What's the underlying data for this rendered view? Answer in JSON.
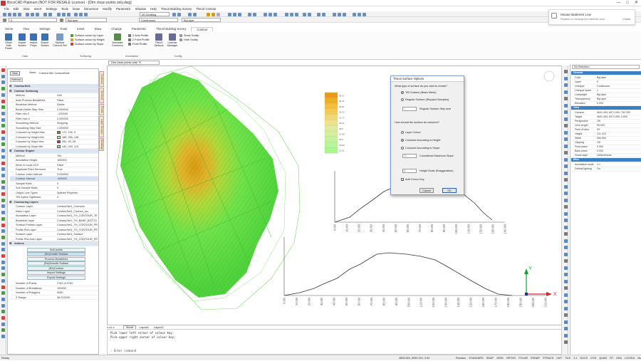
{
  "window": {
    "title": "BricsCAD Platinum (NOT FOR RESALE License) - [Dtm clean points only.dwg]",
    "controls": [
      "—",
      "□",
      "✕"
    ]
  },
  "menu": [
    "File",
    "Edit",
    "View",
    "Insert",
    "Settings",
    "Tools",
    "Draw",
    "Dimension",
    "Modify",
    "Parametric",
    "Window",
    "Help",
    "Theo3 Building Survey",
    "Theo3 Contour"
  ],
  "toolbar": {
    "workspace": "2D Drafting",
    "layer": "0",
    "linetype": "Continuous",
    "color": "ByLayer",
    "lineweight": "ByLayer"
  },
  "ribbon": {
    "tabs": [
      "Home",
      "View",
      "Settings",
      "Tools",
      "Insert",
      "Draw",
      "Change",
      "Parametric",
      "Theo3 Building Survey",
      "Contour"
    ],
    "active_tab": "Contour",
    "buttons": [
      "Show Side Panel",
      "Import Nodes",
      "Import Polys",
      "Export Nodes",
      "Surface Current Set",
      "Annotate Contours",
      "Theo3 Options",
      "License Manager"
    ],
    "small_buttons": [
      "Surface colour by Layer",
      "Surface colour by Height",
      "Surface colour by Slope",
      "X Axis Profile",
      "2 Point Profile",
      "Profil Profile",
      "Show Tooltip",
      "Hide Tooltip"
    ],
    "groups": [
      "Data",
      "Surfacing",
      "Annotation",
      "Config"
    ]
  },
  "notification": {
    "title": "Mouse Batteries Low",
    "body": "Replace or recharge the batteries soon",
    "close": "Close"
  },
  "panel": {
    "new_button": "New",
    "none_button": "None",
    "current_set_label": "Current Set: ContourSet1",
    "refresh_button": "Refresh",
    "rows": [
      {
        "type": "sec",
        "k": "ContourSet1",
        "v": ""
      },
      {
        "type": "sec",
        "k": "Contour Surfacing",
        "v": ""
      },
      {
        "k": "Method",
        "v": "Hull"
      },
      {
        "k": "Auto Process Breaklines",
        "v": "False"
      },
      {
        "k": "Breakline Method",
        "v": "Divide"
      },
      {
        "k": "Break Divide Step Size",
        "v": "2.000000"
      },
      {
        "k": "Filter min Z",
        "v": "-.200000"
      },
      {
        "k": "Filter max Z",
        "v": "2.000000"
      },
      {
        "k": "Smoothing Method",
        "v": "Stepping"
      },
      {
        "k": "Smoothing Step Size",
        "v": "1.000000"
      },
      {
        "k": "Coloured by Height Max",
        "v": "170, 135, 9",
        "sw": "#aa8709"
      },
      {
        "k": "Coloured by Height Min",
        "v": "188, 255, 148",
        "sw": "#bcff94"
      },
      {
        "k": "Coloured by Slope Max",
        "v": "250, 45, 28",
        "sw": "#fa2d1c"
      },
      {
        "k": "Coloured by Slope Min",
        "v": "140, 249, 115",
        "sw": "#8cf973"
      },
      {
        "type": "sec",
        "k": "Contour Engine",
        "v": ""
      },
      {
        "k": "Method",
        "v": "TIN"
      },
      {
        "k": "Annotation Height",
        "v": ".500000"
      },
      {
        "k": "Work in Local UCS",
        "v": "False"
      },
      {
        "k": "Duplicate Point Removal",
        "v": "True"
      },
      {
        "k": "Contour Index Interval",
        "v": "5.000000"
      },
      {
        "type": "sel",
        "k": "Contour Interval",
        "v": ".200000"
      },
      {
        "k": "Sample Ratio",
        "v": "0"
      },
      {
        "k": "Sub Sample Ratio",
        "v": "0"
      },
      {
        "k": "Output Line Types",
        "v": "Splined Polylines"
      },
      {
        "k": "TIN Spline Tightness",
        "v": "0"
      },
      {
        "type": "sec",
        "k": "Contouring Layers",
        "v": ""
      },
      {
        "k": "Contour Layer",
        "v": "ContourSet1_Contours"
      },
      {
        "k": "Index Layer",
        "v": "ContourSet1_Contour_Inc"
      },
      {
        "k": "Annotation Layer",
        "v": "ContourSet1_TH_CONTOUR_TE"
      },
      {
        "k": "Breakline Layer",
        "v": "ContourSet1_TH_BANK_BOTTO"
      },
      {
        "k": "Surface Profiles Layer",
        "v": "ContourSet1_TH_CONTOUR_PR"
      },
      {
        "k": "Profile Plot Layer",
        "v": "ContourSet1_TH_CONTOUR_PR"
      },
      {
        "k": "Surface Layer",
        "v": "ContourSet1_Surface"
      },
      {
        "k": "Profile Plot Axis Layer",
        "v": "ContourSet1_TH_CONTOUR_PR"
      },
      {
        "type": "sec",
        "k": "Actions",
        "v": ""
      }
    ],
    "actions": [
      "Add points",
      "(Re)Create Surface",
      "Process Breaklines",
      "(Re)Smooth Surface",
      "(Re)Contour",
      "Import Settings",
      "Export Settings"
    ],
    "stats": [
      {
        "k": "Number of Points",
        "v": "2781 of 2781"
      },
      {
        "k": "Number of Breaklines",
        "v": "100000"
      },
      {
        "k": "Number of Polygons",
        "v": "5280"
      },
      {
        "k": "Z Range",
        "v": "36.213000"
      }
    ],
    "side_tabs": [
      "Contours",
      "Sections",
      "Points",
      "Layer Groups",
      "Buildings"
    ]
  },
  "document_tab": "Dtm clean points only*",
  "layout_tabs": [
    "Model",
    "Layout1",
    "Layout2"
  ],
  "legend": {
    "values": [
      "38.17",
      "36.31",
      "34.87",
      "33.22",
      "31.72",
      "30.11",
      "28.6",
      "27.08",
      "25.5",
      "23.89",
      "22.31"
    ],
    "colors": [
      "#e79a1a",
      "#edae27",
      "#f1bf3d",
      "#f3cc55",
      "#f2d873",
      "#eee38a",
      "#e3ea98",
      "#d6ef9d",
      "#c7f29d",
      "#b8f498",
      "#acf68f"
    ]
  },
  "profile1": {
    "x_ticks": [
      "0.00",
      "10.00",
      "20.00",
      "30.00",
      "40.00",
      "50.00",
      "60.00",
      "70.00",
      "80.00",
      "90.00",
      "100.00",
      "110.00",
      "120.00",
      "130.00",
      "140.00"
    ]
  },
  "profile2": {
    "x_ticks": [
      "0.00",
      "10.00",
      "20.00",
      "30.00",
      "40.00",
      "50.00",
      "60.00",
      "70.00",
      "80.00",
      "90.00",
      "100.00",
      "110.00",
      "120.00",
      "130.00",
      "140.00",
      "150.00",
      "160.00",
      "170.00",
      "180.00",
      "190.00",
      "200.00",
      "210.00"
    ]
  },
  "ucs": {
    "x": "X",
    "y": "Y"
  },
  "dialog": {
    "title": "Theo3 Surface Options",
    "q1": "What type of surface do you wish to create?",
    "opt_tin": "TIN Surface (Basic Mesh)",
    "opt_regular": "Regular Surface (Stepped Samples)",
    "step_value": "1",
    "step_label": "Regular Surface Step size",
    "q2": "How should the surface be coloured?",
    "opt_layer": "Layer Colour",
    "opt_height": "Coloured According to Height",
    "opt_slope": "Coloured According to Slope",
    "slope_value": "90",
    "slope_label": "Considered Maximum Slope",
    "height_value": "1",
    "height_label": "Height Scale (Exaggeration)",
    "add_keys": "Add Colour Key",
    "cancel": "Cancel",
    "ok": "OK"
  },
  "command": {
    "lines": [
      "Pick lower left corner of colour key:",
      "Pick upper right corner of colour key:"
    ],
    "prompt": ": Enter command"
  },
  "properties": {
    "selector": "No Selection",
    "rows": [
      {
        "type": "sec",
        "k": "General"
      },
      {
        "k": "Color",
        "v": "ByLayer"
      },
      {
        "k": "Layer",
        "v": "0"
      },
      {
        "k": "Linetype",
        "v": "Continuous"
      },
      {
        "k": "Linetype scale",
        "v": "1"
      },
      {
        "k": "Lineweight",
        "v": "ByLayer"
      },
      {
        "k": "Transparency",
        "v": "ByLayer"
      },
      {
        "k": "Elevation",
        "v": "0.000"
      },
      {
        "type": "sec",
        "k": "View"
      },
      {
        "k": "Camera",
        "v": "4641.493, 6071.000, 752.333"
      },
      {
        "k": "Target",
        "v": "4641.493, 6071.000, 0.000"
      },
      {
        "k": "Perspective",
        "v": "Off"
      },
      {
        "k": "Lens length",
        "v": "50.000"
      },
      {
        "k": "Field of view",
        "v": "39"
      },
      {
        "k": "Height",
        "v": "211.223"
      },
      {
        "k": "Width",
        "v": "364.554"
      },
      {
        "k": "Clipping",
        "v": "Off"
      },
      {
        "k": "Front plane",
        "v": "0.000"
      },
      {
        "k": "Back plane",
        "v": "0.000"
      },
      {
        "k": "Visual style",
        "v": "2dWireframe"
      },
      {
        "type": "sec",
        "k": "Misc"
      },
      {
        "k": "Annotation scale",
        "v": "1:1"
      },
      {
        "k": "Default lighting",
        "v": "On"
      }
    ]
  },
  "status": {
    "left": "Ready",
    "coords": "4605.820, 6090.210, 0.00",
    "items": [
      "Romans",
      "STANDARD",
      "SNAP",
      "GRID",
      "ORTHO",
      "POLAR",
      "ESNAP",
      "STRACK",
      "LWT",
      "TILE",
      "1:1",
      "DUCS",
      "DYN",
      "QUAD",
      "RT",
      "HKA",
      "LOCKUI",
      "None"
    ]
  },
  "colors": {
    "accent": "#3b7fc4",
    "surface": "#5ee04a"
  }
}
